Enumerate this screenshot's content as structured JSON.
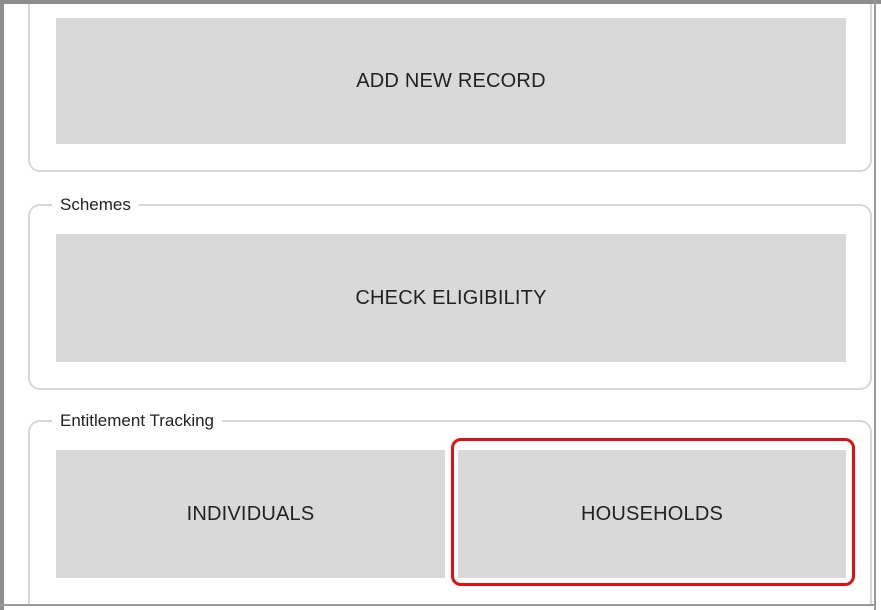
{
  "records": {
    "add_button_label": "ADD NEW RECORD"
  },
  "schemes": {
    "section_title": "Schemes",
    "check_button_label": "CHECK ELIGIBILITY"
  },
  "entitlement": {
    "section_title": "Entitlement Tracking",
    "individuals_button_label": "INDIVIDUALS",
    "households_button_label": "HOUSEHOLDS",
    "highlight_color": "#e01010"
  },
  "colors": {
    "button_bg": "#d8d9d8",
    "section_border": "#d6d6d6",
    "text": "#222222"
  }
}
